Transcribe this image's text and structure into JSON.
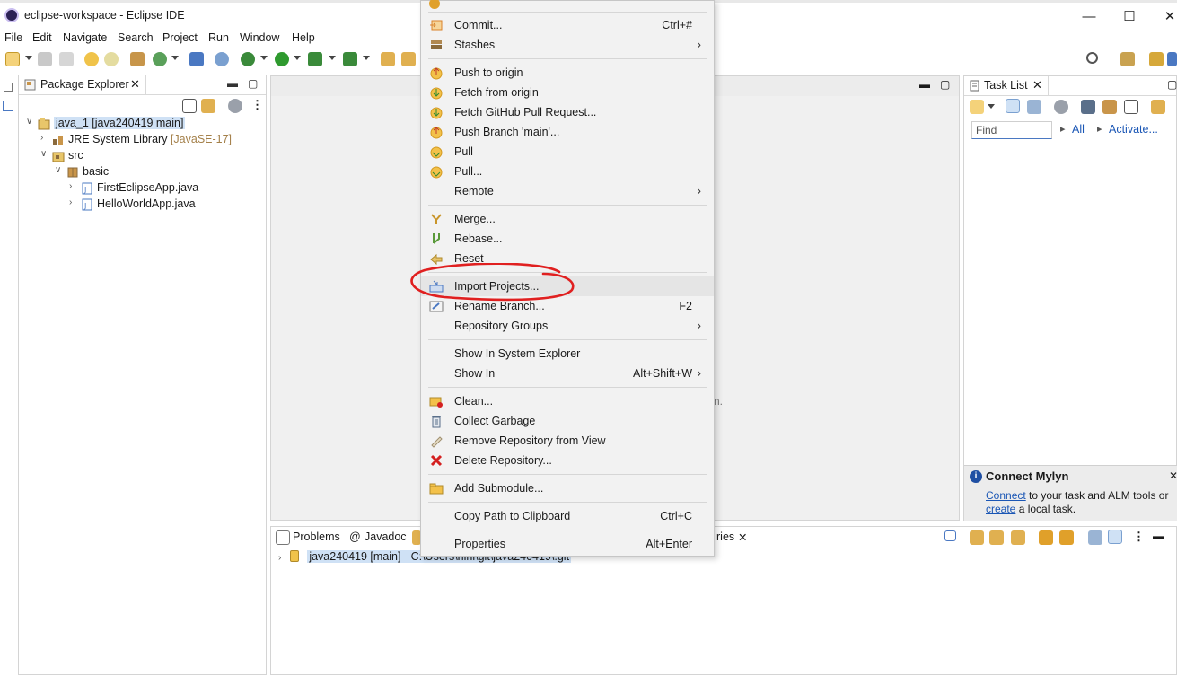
{
  "window": {
    "title": "eclipse-workspace - Eclipse IDE",
    "min": "—",
    "max": "☐",
    "close": "✕"
  },
  "menubar": [
    "File",
    "Edit",
    "Navigate",
    "Search",
    "Project",
    "Run",
    "Window",
    "Help"
  ],
  "package_explorer": {
    "tab_label": "Package Explorer",
    "close": "✕",
    "tree": [
      {
        "arrow": "∨",
        "label": "java_1 [java240419 main]"
      },
      {
        "arrow": "›",
        "label": "JRE System Library",
        "decor": "[JavaSE-17]"
      },
      {
        "arrow": "∨",
        "label": "src"
      },
      {
        "arrow": "∨",
        "label": "basic"
      },
      {
        "arrow": "›",
        "label": "FirstEclipseApp.java"
      },
      {
        "arrow": "›",
        "label": "HelloWorldApp.java"
      }
    ]
  },
  "editor": {
    "hint_fragment": "n."
  },
  "context_menu": {
    "items": [
      {
        "label": "Commit...",
        "shortcut": "Ctrl+#",
        "icon_color": "#d9822b"
      },
      {
        "label": "Stashes",
        "submenu": "›",
        "icon_color": "#8a6a3c"
      },
      {
        "label": "Push to origin",
        "icon_color": "#e0a02a"
      },
      {
        "label": "Fetch from origin",
        "icon_color": "#e0a02a"
      },
      {
        "label": "Fetch GitHub Pull Request...",
        "icon_color": "#e0a02a"
      },
      {
        "label": "Push Branch 'main'...",
        "icon_color": "#e0a02a"
      },
      {
        "label": "Pull",
        "icon_color": "#e0a02a"
      },
      {
        "label": "Pull...",
        "icon_color": "#e0a02a"
      },
      {
        "label": "Remote",
        "submenu": "›"
      },
      {
        "label": "Merge...",
        "icon_color": "#d4a020"
      },
      {
        "label": "Rebase...",
        "icon_color": "#5a9a3a"
      },
      {
        "label": "Reset",
        "icon_color": "#d4a020"
      },
      {
        "label": "Import Projects...",
        "icon_color": "#4a78c2"
      },
      {
        "label": "Rename Branch...",
        "shortcut": "F2",
        "icon_color": "#7a7a7a"
      },
      {
        "label": "Repository Groups",
        "submenu": "›"
      },
      {
        "label": "Show In System Explorer"
      },
      {
        "label": "Show In",
        "shortcut": "Alt+Shift+W",
        "submenu": "›"
      },
      {
        "label": "Clean...",
        "icon_color": "#e0a02a"
      },
      {
        "label": "Collect Garbage",
        "icon_color": "#5a6f8a"
      },
      {
        "label": "Remove Repository from View",
        "icon_color": "#a09070"
      },
      {
        "label": "Delete Repository...",
        "icon_color": "#d42020"
      },
      {
        "label": "Add Submodule...",
        "icon_color": "#e0a02a"
      },
      {
        "label": "Copy Path to Clipboard",
        "shortcut": "Ctrl+C"
      },
      {
        "label": "Properties",
        "shortcut": "Alt+Enter"
      }
    ]
  },
  "bottom_panel": {
    "tabs": [
      "Problems",
      "Javadoc",
      "ries"
    ],
    "javadoc_prefix": "@",
    "close": "✕",
    "repo_row": "java240419 [main] - C:\\Users\\hihi\\git\\java240419\\.git"
  },
  "task_list": {
    "tab_label": "Task List",
    "close": "✕",
    "find_placeholder": "Find",
    "all_link": "All",
    "activate_link": "Activate...",
    "mylyn": {
      "heading": "Connect Mylyn",
      "connect": "Connect",
      "text1": " to your task and ALM tools or",
      "create": "create",
      "text2": " a local task."
    }
  },
  "colors": {
    "accent": "#4a78c2",
    "annotation_red": "#e02020",
    "link": "#1a56b5",
    "selection": "#cfe1f5"
  }
}
